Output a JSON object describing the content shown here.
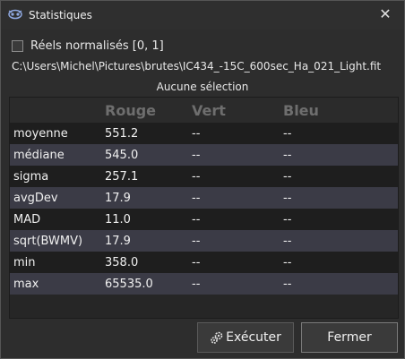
{
  "window": {
    "title": "Statistiques",
    "close_glyph": "✕",
    "app_icon": "siril-logo-icon"
  },
  "options": {
    "normalized_label": "Réels normalisés [0, 1]",
    "normalized_checked": false
  },
  "file_path": "C:\\Users\\Michel\\Pictures\\brutes\\IC434_-15C_600sec_Ha_021_Light.fit",
  "selection_status": "Aucune sélection",
  "table": {
    "headers": [
      "",
      "Rouge",
      "Vert",
      "Bleu"
    ],
    "rows": [
      {
        "name": "moyenne",
        "r": "551.2",
        "g": "--",
        "b": "--"
      },
      {
        "name": "médiane",
        "r": "545.0",
        "g": "--",
        "b": "--"
      },
      {
        "name": "sigma",
        "r": "257.1",
        "g": "--",
        "b": "--"
      },
      {
        "name": "avgDev",
        "r": "17.9",
        "g": "--",
        "b": "--"
      },
      {
        "name": "MAD",
        "r": "11.0",
        "g": "--",
        "b": "--"
      },
      {
        "name": "sqrt(BWMV)",
        "r": "17.9",
        "g": "--",
        "b": "--"
      },
      {
        "name": "min",
        "r": "358.0",
        "g": "--",
        "b": "--"
      },
      {
        "name": "max",
        "r": "65535.0",
        "g": "--",
        "b": "--"
      }
    ]
  },
  "buttons": {
    "run_label": "Exécuter",
    "run_icon": "execute-gears-icon",
    "close_label": "Fermer"
  },
  "colors": {
    "row_even": "#3b3b46",
    "row_odd": "#1e1e1e",
    "header_text": "#6e6e6e"
  }
}
